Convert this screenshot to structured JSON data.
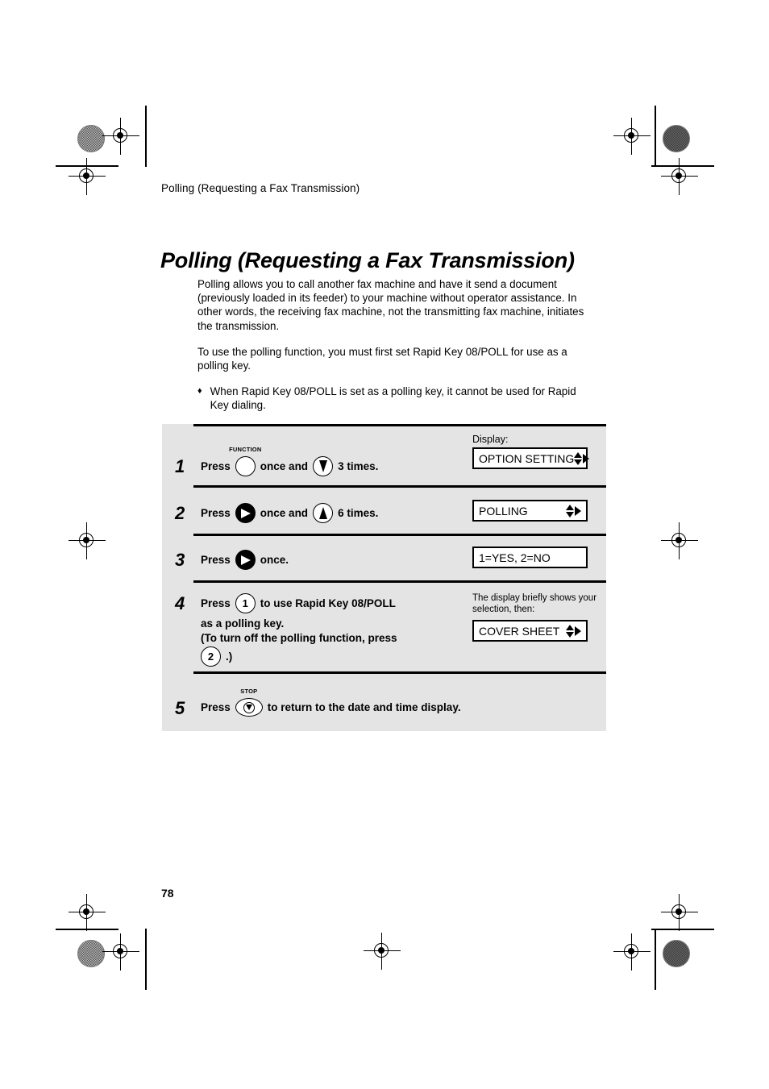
{
  "page": {
    "running_head": "Polling (Requesting a Fax Transmission)",
    "title": "Polling (Requesting a Fax Transmission)",
    "page_number": "78"
  },
  "intro": {
    "para1": "Polling allows you to call another fax machine and have it send a document (previously loaded in its feeder) to your machine without operator assistance. In other words, the receiving fax machine, not the transmitting fax machine, initiates the transmission.",
    "para2": "To use the polling function, you must first set Rapid Key 08/POLL for use as a polling key.",
    "bullet_marker": "♦",
    "bullet1": "When Rapid Key 08/POLL is set as a polling key, it cannot be used for Rapid Key dialing."
  },
  "steps": [
    {
      "number": "1",
      "press_label": "Press",
      "key1_label": "FUNCTION",
      "mid_text": "once and",
      "after_text": "3 times.",
      "display_label": "Display:",
      "display_text": "OPTION SETTING"
    },
    {
      "number": "2",
      "press_label": "Press",
      "mid_text": "once and",
      "after_text": "6 times.",
      "display_text": "POLLING"
    },
    {
      "number": "3",
      "press_label": "Press",
      "after_text": "once.",
      "display_text": "1=YES, 2=NO"
    },
    {
      "number": "4",
      "press_label": "Press",
      "key_digit_1": "1",
      "line1_after": "to use Rapid Key 08/POLL",
      "line2": "as a polling key.",
      "line3": "(To turn off the polling function, press",
      "key_digit_2": "2",
      "line4_after": ".)",
      "note": "The display briefly shows your selection, then:",
      "display_text": "COVER SHEET"
    },
    {
      "number": "5",
      "press_label": "Press",
      "key_label": "STOP",
      "after_text": "to return to the date and time display."
    }
  ]
}
